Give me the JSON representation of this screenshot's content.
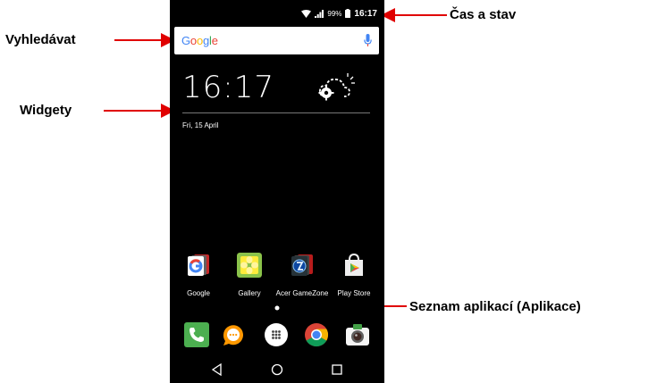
{
  "callouts": {
    "status": "Čas a stav",
    "search": "Vyhledávat",
    "widgets": "Widgety",
    "app_list": "Seznam aplikací (Aplikace)"
  },
  "status_bar": {
    "battery": "99%",
    "time": "16:17",
    "icons": [
      "wifi-icon",
      "signal-icon",
      "battery-icon"
    ]
  },
  "search": {
    "logo_parts": [
      "G",
      "o",
      "o",
      "g",
      "l",
      "e"
    ],
    "mic_icon": "microphone-icon"
  },
  "widget": {
    "clock": "16:17",
    "date": "Fri, 15 April",
    "weather_icon": "weather-settings-icon"
  },
  "apps": [
    {
      "label": "Google",
      "icon": "google-folder-icon"
    },
    {
      "label": "Gallery",
      "icon": "gallery-icon"
    },
    {
      "label": "Acer GameZone",
      "icon": "acer-gamezone-icon"
    },
    {
      "label": "Play Store",
      "icon": "play-store-icon"
    }
  ],
  "dock": [
    {
      "icon": "phone-icon"
    },
    {
      "icon": "messaging-icon"
    },
    {
      "icon": "app-drawer-icon"
    },
    {
      "icon": "chrome-icon"
    },
    {
      "icon": "camera-icon"
    }
  ],
  "nav": [
    "back-icon",
    "home-icon",
    "recents-icon"
  ],
  "colors": {
    "arrow": "#e00000",
    "google_blue": "#4285f4",
    "google_red": "#ea4335",
    "google_yellow": "#fbbc05",
    "google_green": "#34a853"
  }
}
